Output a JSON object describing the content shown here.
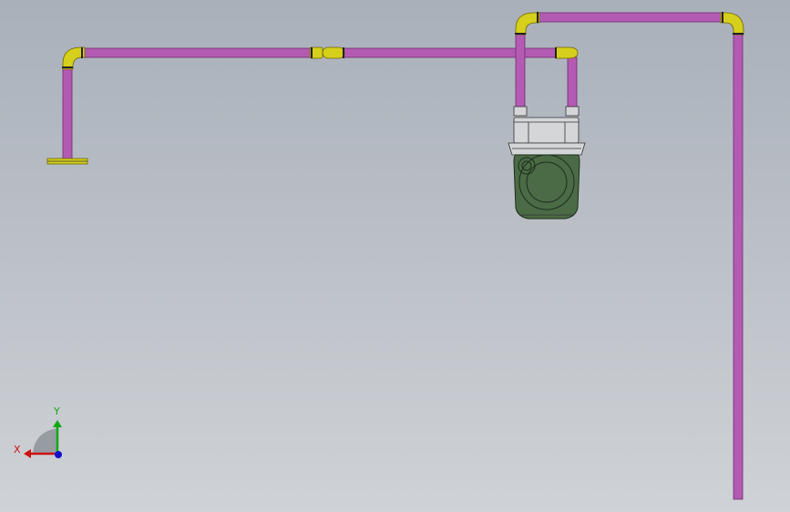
{
  "view": {
    "background_top": "#a9b0ba",
    "background_bottom": "#cfd2d6"
  },
  "colors": {
    "pipe": "#b35bb2",
    "pipe_edge": "#6e2a6e",
    "fitting": "#d6cf1c",
    "fitting_edge": "#6b6600",
    "meter_body": "#4a6b45",
    "meter_edge": "#1e2e1c",
    "meter_head": "#d4d6d8"
  },
  "triad": {
    "x_label": "X",
    "y_label": "Y",
    "x_color": "#cc1111",
    "y_color": "#11aa11",
    "z_color": "#1111cc"
  }
}
